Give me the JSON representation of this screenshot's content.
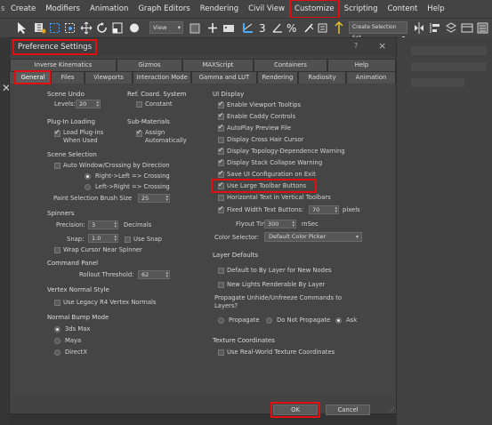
{
  "menu": [
    "Create",
    "Modifiers",
    "Animation",
    "Graph Editors",
    "Rendering",
    "Civil View",
    "Customize",
    "Scripting",
    "Content",
    "Help"
  ],
  "toolbar": {
    "view_dropdown": "View",
    "selection_set_dropdown": "Create Selection Set"
  },
  "dialog": {
    "title": "Preference Settings",
    "help": "?",
    "close": "×",
    "tabs_row1": [
      "Inverse Kinematics",
      "Gizmos",
      "MAXScript",
      "Containers",
      "Help"
    ],
    "tabs_row2": [
      "General",
      "Files",
      "Viewports",
      "Interaction Mode",
      "Gamma and LUT",
      "Rendering",
      "Radiosity",
      "Animation"
    ],
    "scene_undo": {
      "title": "Scene Undo",
      "levels_label": "Levels:",
      "levels_value": "20"
    },
    "ref_coord": {
      "title": "Ref. Coord. System",
      "constant": "Constant"
    },
    "plugin_loading": {
      "title": "Plug-In Loading",
      "load_plugins_1": "Load Plug-ins",
      "load_plugins_2": "When Used"
    },
    "sub_materials": {
      "title": "Sub-Materials",
      "assign_1": "Assign",
      "assign_2": "Automatically"
    },
    "scene_selection": {
      "title": "Scene Selection",
      "auto_window": "Auto Window/Crossing by Direction",
      "right_left": "Right->Left => Crossing",
      "left_right": "Left->Right => Crossing",
      "brush_label": "Paint Selection Brush Size",
      "brush_value": "25"
    },
    "spinners": {
      "title": "Spinners",
      "precision_label": "Precision:",
      "precision_value": "3",
      "decimals": "Decimals",
      "snap_label": "Snap:",
      "snap_value": "1.0",
      "use_snap": "Use Snap",
      "wrap_cursor": "Wrap Cursor Near Spinner"
    },
    "command_panel": {
      "title": "Command Panel",
      "rollout_label": "Rollout Threshold:",
      "rollout_value": "62"
    },
    "vertex_normal": {
      "title": "Vertex Normal Style",
      "legacy": "Use Legacy R4 Vertex Normals"
    },
    "normal_bump": {
      "title": "Normal Bump Mode",
      "opt1": "3ds Max",
      "opt2": "Maya",
      "opt3": "DirectX"
    },
    "ui_display": {
      "title": "UI Display",
      "items": [
        "Enable Viewport Tooltips",
        "Enable Caddy Controls",
        "AutoPlay Preview File",
        "Display Cross Hair Cursor",
        "Display Topology-Dependence Warning",
        "Display Stack Collapse Warning",
        "Save UI Configuration on Exit",
        "Use Large Toolbar Buttons",
        "Horizontal Text in Vertical Toolbars"
      ],
      "fixed_width_label": "Fixed Width Text Buttons:",
      "fixed_width_value": "70",
      "fixed_width_unit": "pixels",
      "flyout_label": "Flyout Time:",
      "flyout_value": "300",
      "flyout_unit": "mSec",
      "color_selector_label": "Color Selector:",
      "color_selector_value": "Default Color Picker"
    },
    "layer_defaults": {
      "title": "Layer Defaults",
      "by_layer": "Default to By Layer for New Nodes",
      "new_lights": "New Lights Renderable By Layer",
      "propagate_q": "Propagate Unhide/Unfreeze Commands to Layers?",
      "propagate": "Propagate",
      "do_not": "Do Not Propagate",
      "ask": "Ask"
    },
    "texture_coords": {
      "title": "Texture Coordinates",
      "real_world": "Use Real-World Texture Coordinates"
    },
    "ok_label": "OK",
    "cancel_label": "Cancel"
  },
  "colors": {
    "highlight": "#e01010",
    "dialog_bg": "#434343"
  }
}
